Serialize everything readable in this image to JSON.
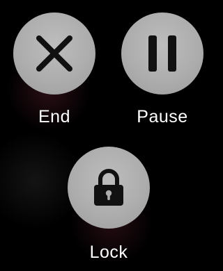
{
  "actions": {
    "end": {
      "label": "End",
      "icon": "close-icon"
    },
    "pause": {
      "label": "Pause",
      "icon": "pause-icon"
    },
    "lock": {
      "label": "Lock",
      "icon": "lock-icon"
    }
  },
  "colors": {
    "button_fill": "#adadad",
    "icon": "#111111",
    "label": "#ffffff",
    "background": "#000000"
  }
}
